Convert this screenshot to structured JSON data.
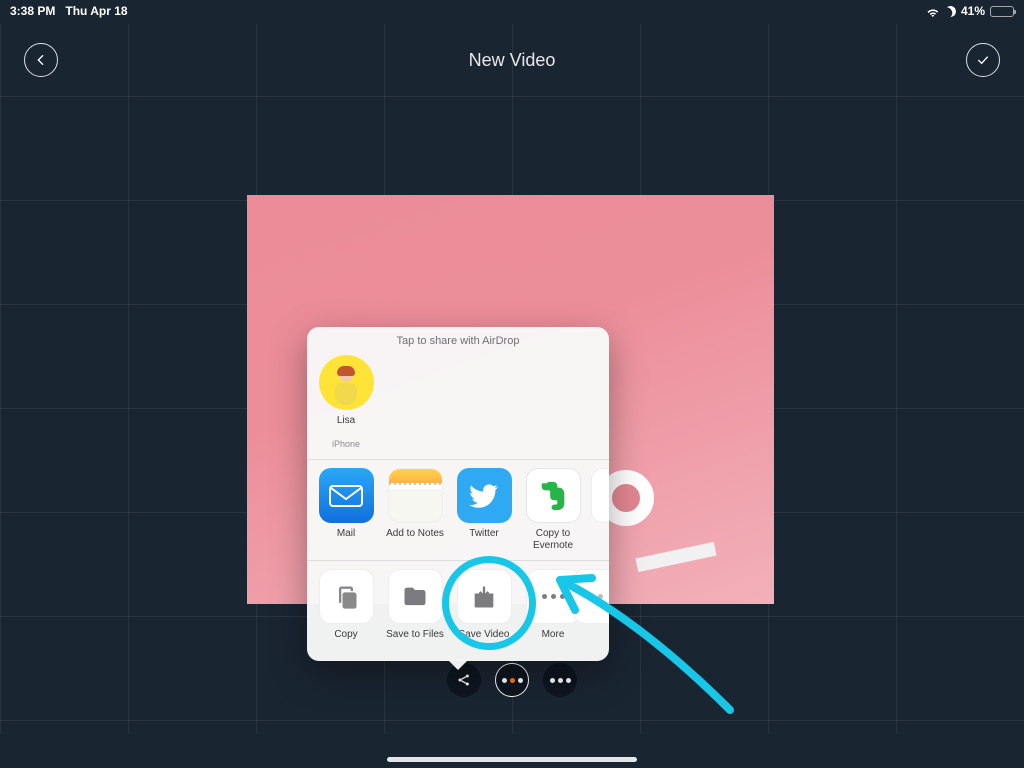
{
  "status": {
    "time": "3:38 PM",
    "date": "Thu Apr 18",
    "battery_pct": "41%"
  },
  "header": {
    "title": "New Video"
  },
  "share": {
    "hint": "Tap to share with AirDrop",
    "airdrop": {
      "name": "Lisa",
      "device": "iPhone"
    },
    "apps": [
      {
        "label": "Mail"
      },
      {
        "label": "Add to Notes"
      },
      {
        "label": "Twitter"
      },
      {
        "label": "Copy to Evernote"
      }
    ],
    "actions": [
      {
        "label": "Copy"
      },
      {
        "label": "Save to Files"
      },
      {
        "label": "Save Video"
      },
      {
        "label": "More"
      }
    ]
  }
}
